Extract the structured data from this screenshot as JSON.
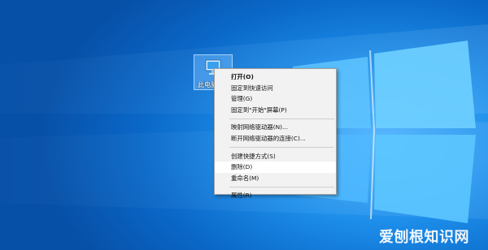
{
  "desktop": {
    "icon": {
      "name": "此电脑",
      "icon": "computer-icon"
    }
  },
  "context_menu": {
    "items": [
      {
        "label": "打开(O)",
        "bold": true
      },
      {
        "label": "固定到快速访问"
      },
      {
        "label": "管理(G)"
      },
      {
        "label": "固定到\"开始\"屏幕(P)"
      },
      {
        "label": "映射网络驱动器(N)..."
      },
      {
        "label": "断开网络驱动器的连接(C)..."
      },
      {
        "label": "创建快捷方式(S)"
      },
      {
        "label": "删除(D)",
        "highlighted": true
      },
      {
        "label": "重命名(M)"
      },
      {
        "label": "属性(R)"
      }
    ]
  },
  "watermark": {
    "text": "爱刨根知识网"
  },
  "colors": {
    "desktop_blue": "#0a68c8",
    "menu_bg": "#f2f2f2",
    "menu_hover": "#ffffff"
  }
}
